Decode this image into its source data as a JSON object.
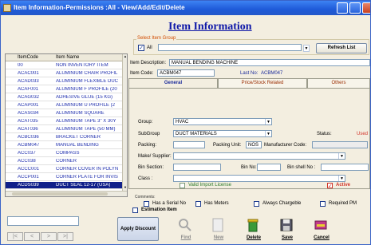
{
  "window": {
    "title": "Item Information-Permissions :All - View/Add/Edit/Delete"
  },
  "page": {
    "heading": "Item Information"
  },
  "item_group": {
    "legend": "Select Item Group",
    "all_label": "All",
    "all_checked": true,
    "combo_value": "",
    "refresh_label": "Refresh List"
  },
  "grid": {
    "columns": [
      "ItemCode",
      "Item Name"
    ],
    "selected_index": 15,
    "rows": [
      {
        "code": "00",
        "name": "NON INVENTORY ITEM"
      },
      {
        "code": "ACAC001",
        "name": "ALUMINIUM CHAIR PROFIL"
      },
      {
        "code": "ACAD033",
        "name": "ALUMINIUM FLEXIBLE DUC"
      },
      {
        "code": "ACAF001",
        "name": "ALUMINIUM F PROFILE (20"
      },
      {
        "code": "ACAG032",
        "name": "ADHESIVE GLUE (15 KG)"
      },
      {
        "code": "ACAP001",
        "name": "ALUMINIUM U PROFILE (2"
      },
      {
        "code": "ACAS034",
        "name": "ALUMINIUM SQUARE"
      },
      {
        "code": "ACAT035",
        "name": "ALUMINIUM TAPE 3\" X 30Y"
      },
      {
        "code": "ACAT036",
        "name": "ALUMINIUM TAPE (50 MM)"
      },
      {
        "code": "ACBC036",
        "name": "BRACKET CORNER"
      },
      {
        "code": "ACBM047",
        "name": "MANUAL BENDING"
      },
      {
        "code": "ACC037",
        "name": "COMPASS"
      },
      {
        "code": "ACC038",
        "name": "CORNER"
      },
      {
        "code": "ACCC001",
        "name": "CORNER COVER IN POLYN"
      },
      {
        "code": "ACCP001",
        "name": "CORNER PLATE FOR INVIS"
      },
      {
        "code": "ACDS039",
        "name": "DUCT SEAL 12-17 (USA)"
      }
    ]
  },
  "details": {
    "description_label": "Item Description:",
    "description_value": "MANUAL BENDING MACHINE",
    "code_label": "Item Code:",
    "code_value": "ACBM047",
    "last_no_label": "Last No:",
    "last_no_value": "ACBM047"
  },
  "tabs": [
    "General",
    "Price/Stock Related",
    "Others"
  ],
  "general": {
    "group_label": "Group:",
    "group_value": "HVAC",
    "subgroup_label": "SubGroup",
    "subgroup_value": "DUCT MATERIALS",
    "status_label": "Status:",
    "status_value": "Used",
    "packing_label": "Packing:",
    "packing_value": "",
    "packing_unit_label": "Packing Unit:",
    "packing_unit_value": "NOS",
    "manufacturer_code_label": "Manufacturer Code:",
    "manufacturer_code_value": "",
    "make_supplier_label": "Make/ Supplier:",
    "make_supplier_value": "",
    "bin_section_label": "Bin Section:",
    "bin_section_value": "",
    "bin_no_label": "Bin No:",
    "bin_no_value": "",
    "bin_shell_no_label": "Bin shell No :",
    "bin_shell_no_value": "",
    "class_label": "Class :",
    "class_value": "",
    "valid_import_label": "Valid Import License",
    "active_label": "Active",
    "active_checked": true,
    "has_serial_label": "Has a Serial No",
    "has_meters_label": "Has Meters",
    "always_chargeable_label": "Always Chargeble",
    "required_pm_label": "Required PM"
  },
  "comments_label": "Comments:",
  "estimation_label": "Estimation Item",
  "search_value": "",
  "apply_discount_label": "Apply Discount",
  "toolbar": [
    {
      "label": "Find",
      "icon": "find-icon"
    },
    {
      "label": "New",
      "icon": "new-icon"
    },
    {
      "label": "Delete",
      "icon": "delete-icon"
    },
    {
      "label": "Save",
      "icon": "save-icon"
    },
    {
      "label": "Cancel",
      "icon": "cancel-icon"
    }
  ],
  "nav": [
    "|<",
    "<",
    ">",
    ">|"
  ],
  "colors": {
    "title_blue": "#1e5ad8",
    "heading": "#0f18a8",
    "legend": "#d24c00",
    "status_used": "#d2342a",
    "active_red": "#d2342a",
    "selected_row": "#10208a"
  }
}
